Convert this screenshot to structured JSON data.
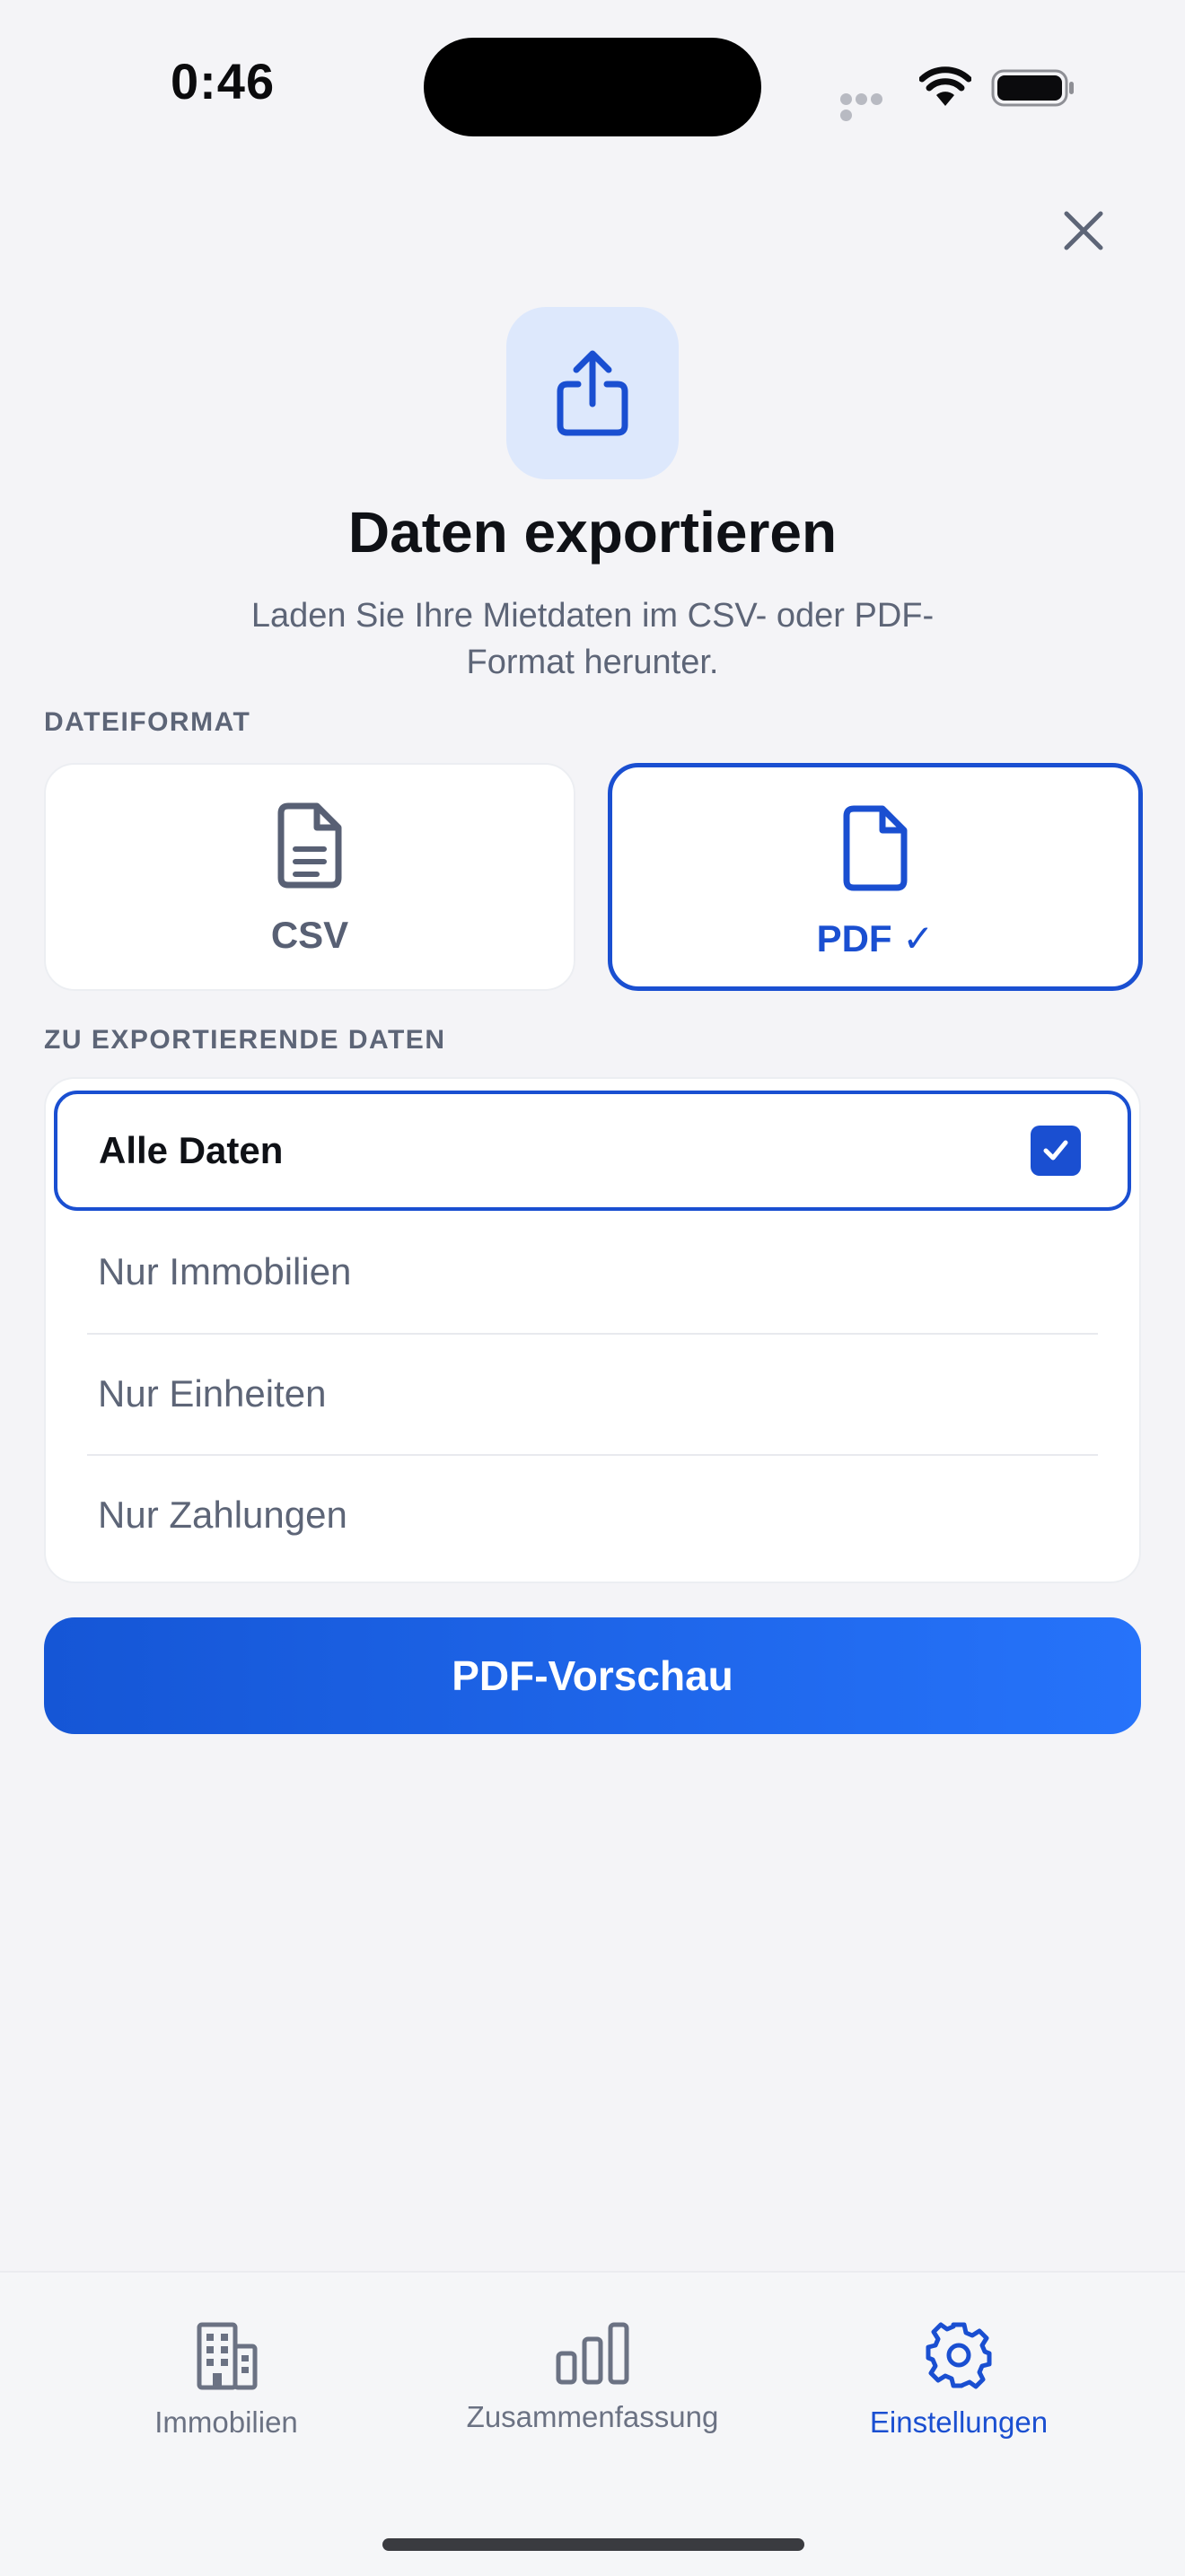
{
  "status_bar": {
    "time": "0:46"
  },
  "header": {
    "title": "Daten exportieren",
    "subtitle_line1": "Laden Sie Ihre Mietdaten im CSV- oder PDF-",
    "subtitle_line2": "Format herunter.",
    "hero_icon": "share-export-icon"
  },
  "format_section": {
    "label": "DATEIFORMAT",
    "options": [
      {
        "label": "CSV",
        "icon": "document-lines-icon",
        "selected": false
      },
      {
        "label": "PDF ✓",
        "icon": "document-icon",
        "selected": true
      }
    ]
  },
  "scope_section": {
    "label": "ZU EXPORTIERENDE DATEN",
    "options": [
      {
        "label": "Alle Daten",
        "selected": true
      },
      {
        "label": "Nur Immobilien",
        "selected": false
      },
      {
        "label": "Nur Einheiten",
        "selected": false
      },
      {
        "label": "Nur Zahlungen",
        "selected": false
      }
    ]
  },
  "primary_action": {
    "label": "PDF-Vorschau"
  },
  "tabbar": {
    "tabs": [
      {
        "label": "Immobilien",
        "icon": "building-icon",
        "active": false
      },
      {
        "label": "Zusammenfassung",
        "icon": "bar-chart-icon",
        "active": false
      },
      {
        "label": "Einstellungen",
        "icon": "gear-icon",
        "active": true
      }
    ]
  },
  "colors": {
    "accent": "#1a4fd1",
    "background": "#f4f4f7",
    "muted_text": "#5d6577",
    "hero_tile": "#dde8fc"
  }
}
